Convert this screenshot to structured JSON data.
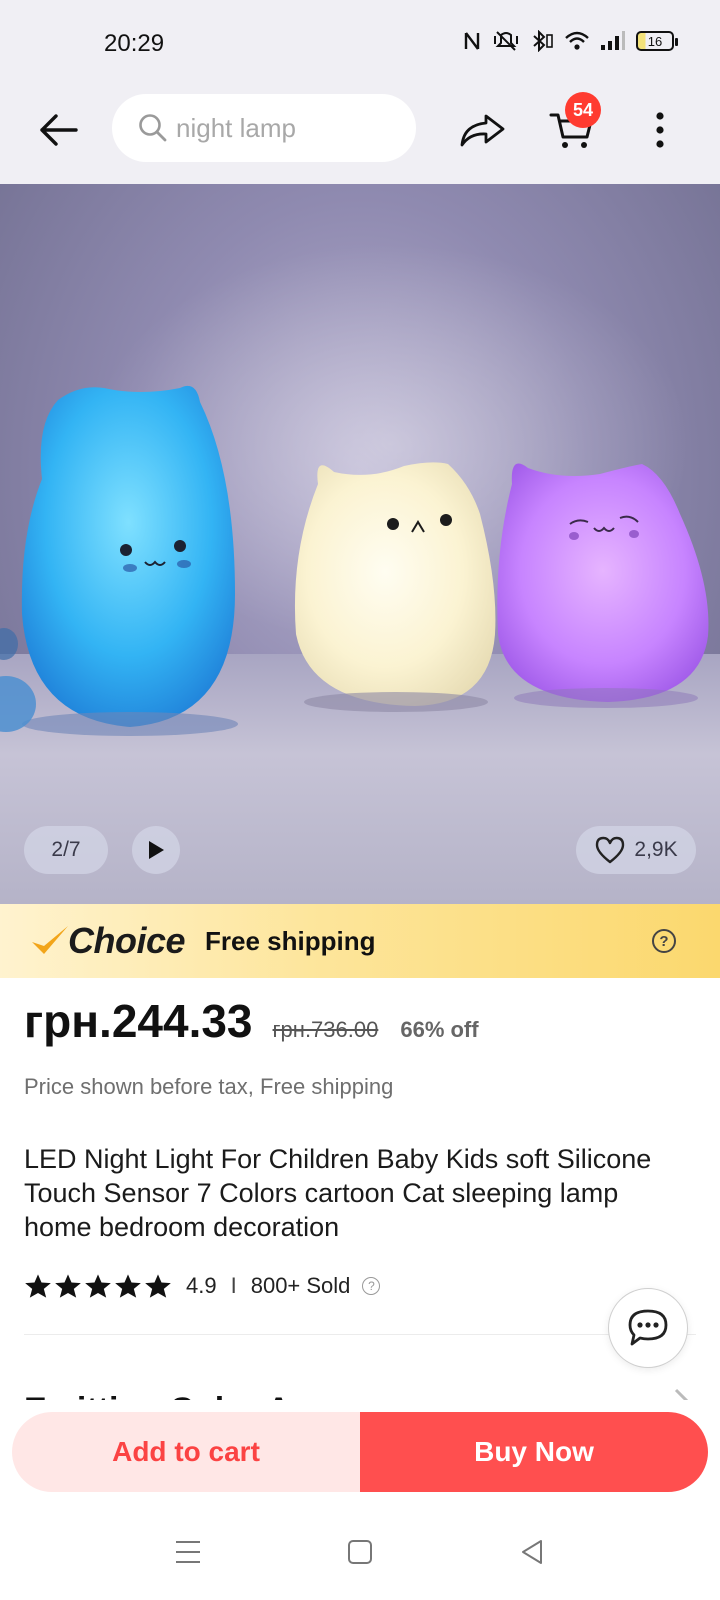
{
  "status_bar": {
    "time": "20:29",
    "battery_level": "16",
    "icons": [
      "nfc-icon",
      "mute-vibrate-icon",
      "bluetooth-icon",
      "wifi-icon",
      "signal-icon",
      "battery-icon"
    ]
  },
  "top_nav": {
    "search_placeholder": "night lamp",
    "cart_count": "54"
  },
  "gallery": {
    "counter": "2/7",
    "likes": "2,9K"
  },
  "choice_banner": {
    "brand": "Choice",
    "label": "Free shipping",
    "help": "?"
  },
  "price": {
    "current": "грн.244.33",
    "original": "грн.736.00",
    "discount": "66% off",
    "note": "Price shown before tax, Free shipping"
  },
  "product": {
    "title": "LED Night Light For Children Baby Kids soft Silicone Touch Sensor 7 Colors cartoon Cat sleeping lamp home bedroom decoration",
    "rating": "4.9",
    "stars": 5,
    "separator": "I",
    "sold": "800+ Sold",
    "sold_help": "?",
    "next_section_partial": "Emitting Color A"
  },
  "actions": {
    "add_to_cart": "Add to cart",
    "buy_now": "Buy Now"
  },
  "colors": {
    "accent_red": "#ff4f4f",
    "cart_badge": "#ff3b30",
    "add_to_cart_bg": "#ffe7e6",
    "choice_gold": "#fbd86e",
    "choice_check": "#f2a51a"
  }
}
